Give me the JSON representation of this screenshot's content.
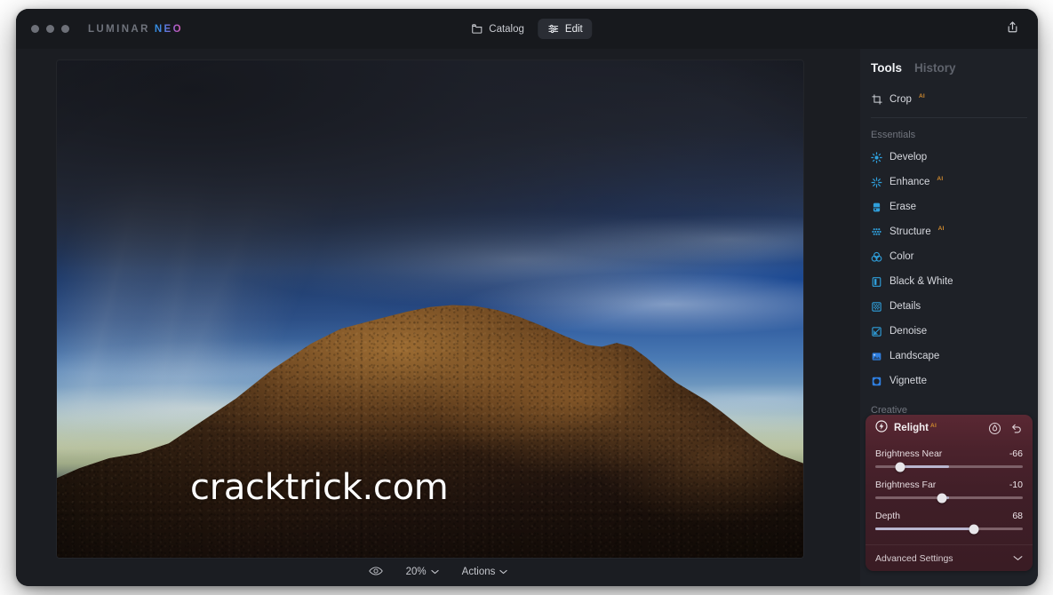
{
  "window": {
    "brand_primary": "LUMINAR",
    "brand_accent": "NEO",
    "accent_gradient_from": "#2f8fe0",
    "accent_gradient_to": "#e05aa8"
  },
  "titlebar": {
    "nav": [
      {
        "label": "Catalog",
        "icon": "folder-icon",
        "active": false
      },
      {
        "label": "Edit",
        "icon": "sliders-icon",
        "active": true
      }
    ],
    "share": {
      "icon": "share-export-icon",
      "label": "Share"
    }
  },
  "canvas": {
    "watermark": "cracktrick.com",
    "photo_alt": "Desert mountain ridge at sunset under dramatic blue storm clouds"
  },
  "bottom_bar": {
    "preview_icon": "eye-icon",
    "zoom_level": "20%",
    "zoom_chevron": "chevron-down-icon",
    "actions_label": "Actions",
    "actions_chevron": "chevron-down-icon"
  },
  "sidebar": {
    "tabs": [
      {
        "label": "Tools",
        "active": true
      },
      {
        "label": "History",
        "active": false
      }
    ],
    "crop": {
      "label": "Crop",
      "icon": "crop-icon",
      "ai": "AI"
    },
    "groups": [
      {
        "label": "Essentials",
        "tools": [
          {
            "label": "Develop",
            "icon": "develop-icon",
            "ai": ""
          },
          {
            "label": "Enhance",
            "icon": "enhance-icon",
            "ai": "AI"
          },
          {
            "label": "Erase",
            "icon": "erase-icon",
            "ai": ""
          },
          {
            "label": "Structure",
            "icon": "structure-icon",
            "ai": "AI"
          },
          {
            "label": "Color",
            "icon": "color-icon",
            "ai": ""
          },
          {
            "label": "Black & White",
            "icon": "bw-icon",
            "ai": ""
          },
          {
            "label": "Details",
            "icon": "details-icon",
            "ai": ""
          },
          {
            "label": "Denoise",
            "icon": "denoise-icon",
            "ai": ""
          },
          {
            "label": "Landscape",
            "icon": "landscape-icon",
            "ai": ""
          },
          {
            "label": "Vignette",
            "icon": "vignette-icon",
            "ai": ""
          }
        ]
      },
      {
        "label": "Creative",
        "tools": []
      }
    ]
  },
  "relight": {
    "title": "Relight",
    "ai": "AI",
    "mask_icon": "mask-circle-icon",
    "reset_icon": "undo-icon",
    "panel_color": "#4b222c",
    "sliders": [
      {
        "label": "Brightness Near",
        "value": "-66",
        "knob_pct": 17,
        "fill_from_pct": 17,
        "fill_to_pct": 50
      },
      {
        "label": "Brightness Far",
        "value": "-10",
        "knob_pct": 45,
        "fill_from_pct": 45,
        "fill_to_pct": 50
      },
      {
        "label": "Depth",
        "value": "68",
        "knob_pct": 67,
        "fill_from_pct": 0,
        "fill_to_pct": 67
      }
    ],
    "advanced": {
      "label": "Advanced Settings",
      "chevron": "chevron-down-icon"
    }
  }
}
